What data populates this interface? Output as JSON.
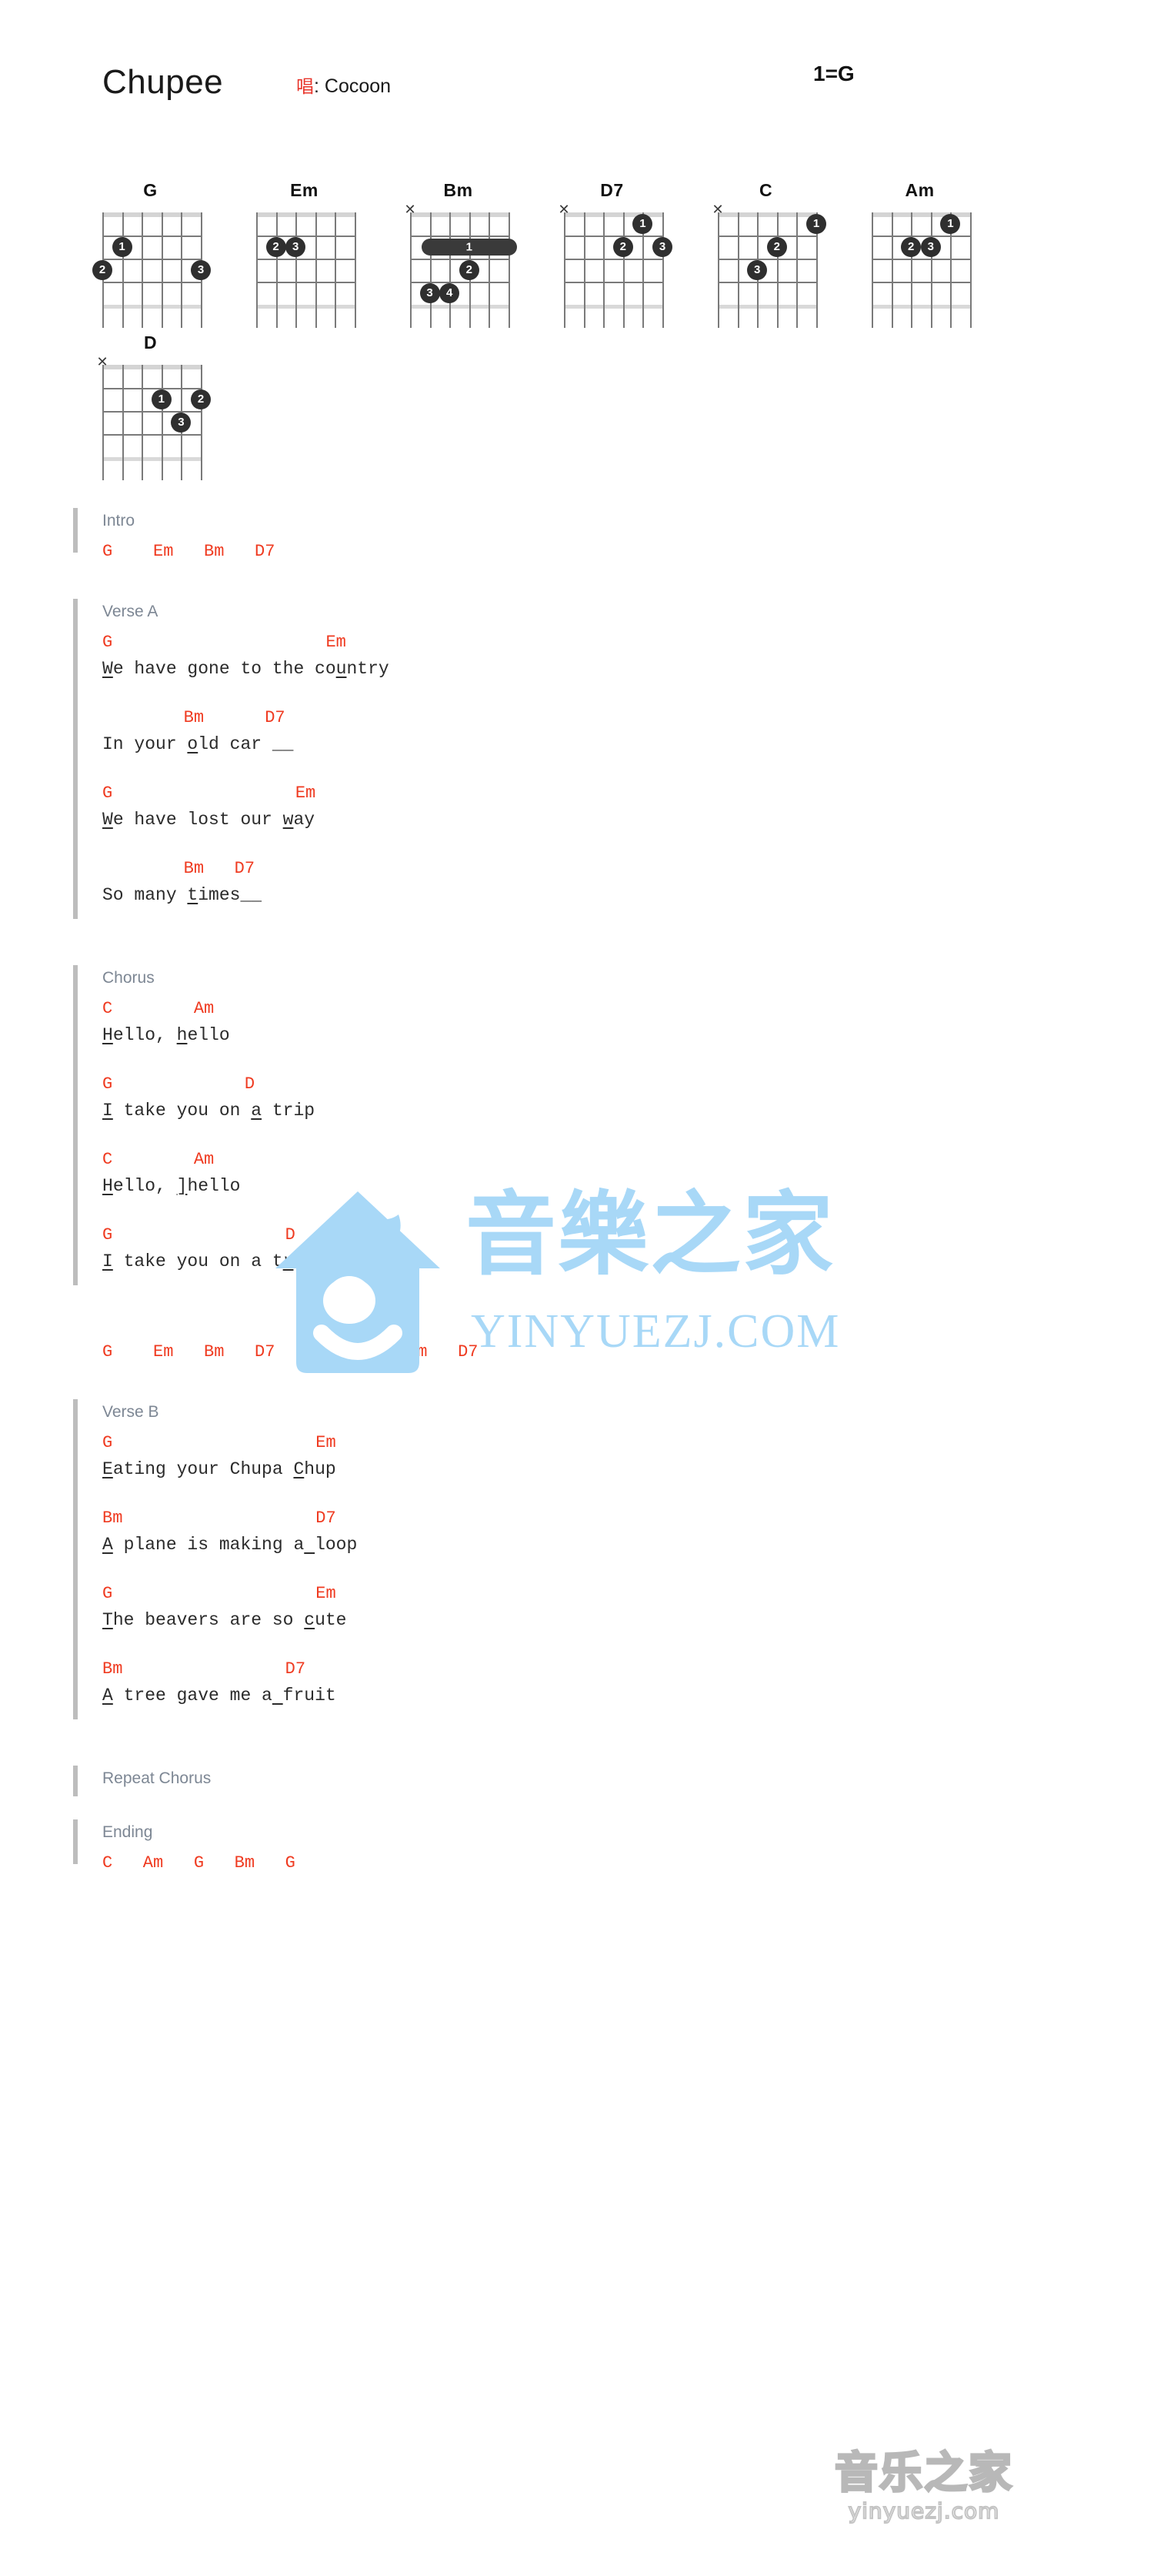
{
  "header": {
    "title": "Chupee",
    "sing_prefix": "唱",
    "artist": ": Cocoon",
    "key": "1=G"
  },
  "chord_diagrams": [
    {
      "name": "G",
      "mute": null,
      "dots": [
        {
          "string": 5,
          "fret": 2,
          "finger": "1"
        },
        {
          "string": 6,
          "fret": 3,
          "finger": "2"
        },
        {
          "string": 1,
          "fret": 3,
          "finger": "3"
        }
      ],
      "barre": null
    },
    {
      "name": "Em",
      "mute": null,
      "dots": [
        {
          "string": 5,
          "fret": 2,
          "finger": "2"
        },
        {
          "string": 4,
          "fret": 2,
          "finger": "3"
        }
      ],
      "barre": null
    },
    {
      "name": "Bm",
      "mute": "6",
      "dots": [
        {
          "string": 3,
          "fret": 3,
          "finger": "2"
        },
        {
          "string": 5,
          "fret": 4,
          "finger": "3"
        },
        {
          "string": 4,
          "fret": 4,
          "finger": "4"
        }
      ],
      "barre": {
        "fret": 2,
        "from": 5,
        "to": 1,
        "finger": "1"
      }
    },
    {
      "name": "D7",
      "mute": "6",
      "dots": [
        {
          "string": 2,
          "fret": 1,
          "finger": "1"
        },
        {
          "string": 3,
          "fret": 2,
          "finger": "2"
        },
        {
          "string": 1,
          "fret": 2,
          "finger": "3"
        }
      ],
      "barre": null
    },
    {
      "name": "C",
      "mute": "6",
      "dots": [
        {
          "string": 1,
          "fret": 1,
          "finger": "1"
        },
        {
          "string": 3,
          "fret": 2,
          "finger": "2"
        },
        {
          "string": 4,
          "fret": 3,
          "finger": "3"
        }
      ],
      "barre": null
    },
    {
      "name": "Am",
      "mute": null,
      "dots": [
        {
          "string": 2,
          "fret": 1,
          "finger": "1"
        },
        {
          "string": 4,
          "fret": 2,
          "finger": "2"
        },
        {
          "string": 3,
          "fret": 2,
          "finger": "3"
        }
      ],
      "barre": null
    },
    {
      "name": "D",
      "mute": "6",
      "dots": [
        {
          "string": 3,
          "fret": 2,
          "finger": "1"
        },
        {
          "string": 1,
          "fret": 2,
          "finger": "2"
        },
        {
          "string": 2,
          "fret": 3,
          "finger": "3"
        }
      ],
      "barre": null
    }
  ],
  "sections": [
    {
      "label": "Intro",
      "lines": [
        {
          "type": "chord",
          "text": "G    Em   Bm   D7"
        }
      ]
    },
    {
      "label": "Verse A",
      "lines": [
        {
          "type": "chord",
          "text": "G                     Em"
        },
        {
          "type": "lyric",
          "text": "We have gone to the country",
          "underline": [
            0,
            22
          ]
        },
        {
          "type": "chord",
          "text": "        Bm      D7"
        },
        {
          "type": "lyric",
          "text": "In your old car __",
          "underline": [
            8
          ]
        },
        {
          "type": "chord",
          "text": "G                  Em"
        },
        {
          "type": "lyric",
          "text": "We have lost our way",
          "underline": [
            0,
            17
          ]
        },
        {
          "type": "chord",
          "text": "        Bm   D7"
        },
        {
          "type": "lyric",
          "text": "So many times__",
          "underline": [
            8
          ]
        }
      ]
    },
    {
      "label": "Chorus",
      "lines": [
        {
          "type": "chord",
          "text": "C        Am"
        },
        {
          "type": "lyric",
          "text": "Hello, hello",
          "underline": [
            0,
            7
          ]
        },
        {
          "type": "chord",
          "text": "G             D"
        },
        {
          "type": "lyric",
          "text": "I take you on a trip",
          "underline": [
            0,
            14
          ]
        },
        {
          "type": "chord",
          "text": "C        Am"
        },
        {
          "type": "lyric",
          "text": "Hello, ]hello",
          "underline": [
            0,
            7
          ]
        },
        {
          "type": "chord",
          "text": "G                 D"
        },
        {
          "type": "lyric",
          "text": "I take you on a trip",
          "underline": [
            0,
            17
          ]
        }
      ]
    },
    {
      "label": "",
      "lines": [
        {
          "type": "chord",
          "text": "G    Em   Bm   D7   G    Em   Bm   D7"
        }
      ]
    },
    {
      "label": "Verse B",
      "lines": [
        {
          "type": "chord",
          "text": "G                    Em"
        },
        {
          "type": "lyric",
          "text": "Eating your Chupa Chup",
          "underline": [
            0,
            18
          ]
        },
        {
          "type": "chord",
          "text": "Bm                   D7"
        },
        {
          "type": "lyric",
          "text": "A plane is making a loop",
          "underline": [
            0,
            19
          ]
        },
        {
          "type": "chord",
          "text": "G                    Em"
        },
        {
          "type": "lyric",
          "text": "The beavers are so cute",
          "underline": [
            0,
            19
          ]
        },
        {
          "type": "chord",
          "text": "Bm                D7"
        },
        {
          "type": "lyric",
          "text": "A tree gave me a fruit",
          "underline": [
            0,
            16
          ]
        }
      ]
    },
    {
      "label": "Repeat Chorus",
      "lines": []
    },
    {
      "label": "Ending",
      "lines": [
        {
          "type": "chord",
          "text": "C   Am   G   Bm   G"
        }
      ]
    }
  ],
  "watermark_main": {
    "chinese": "音樂之家",
    "english": "YINYUEZJ.COM"
  },
  "watermark_bottom": {
    "chinese": "音乐之家",
    "english": "yinyuezj.com"
  },
  "colors": {
    "chord_red": "#ef3b21",
    "section_label": "#7d8794",
    "watermark_blue": "#a8d8f7"
  }
}
